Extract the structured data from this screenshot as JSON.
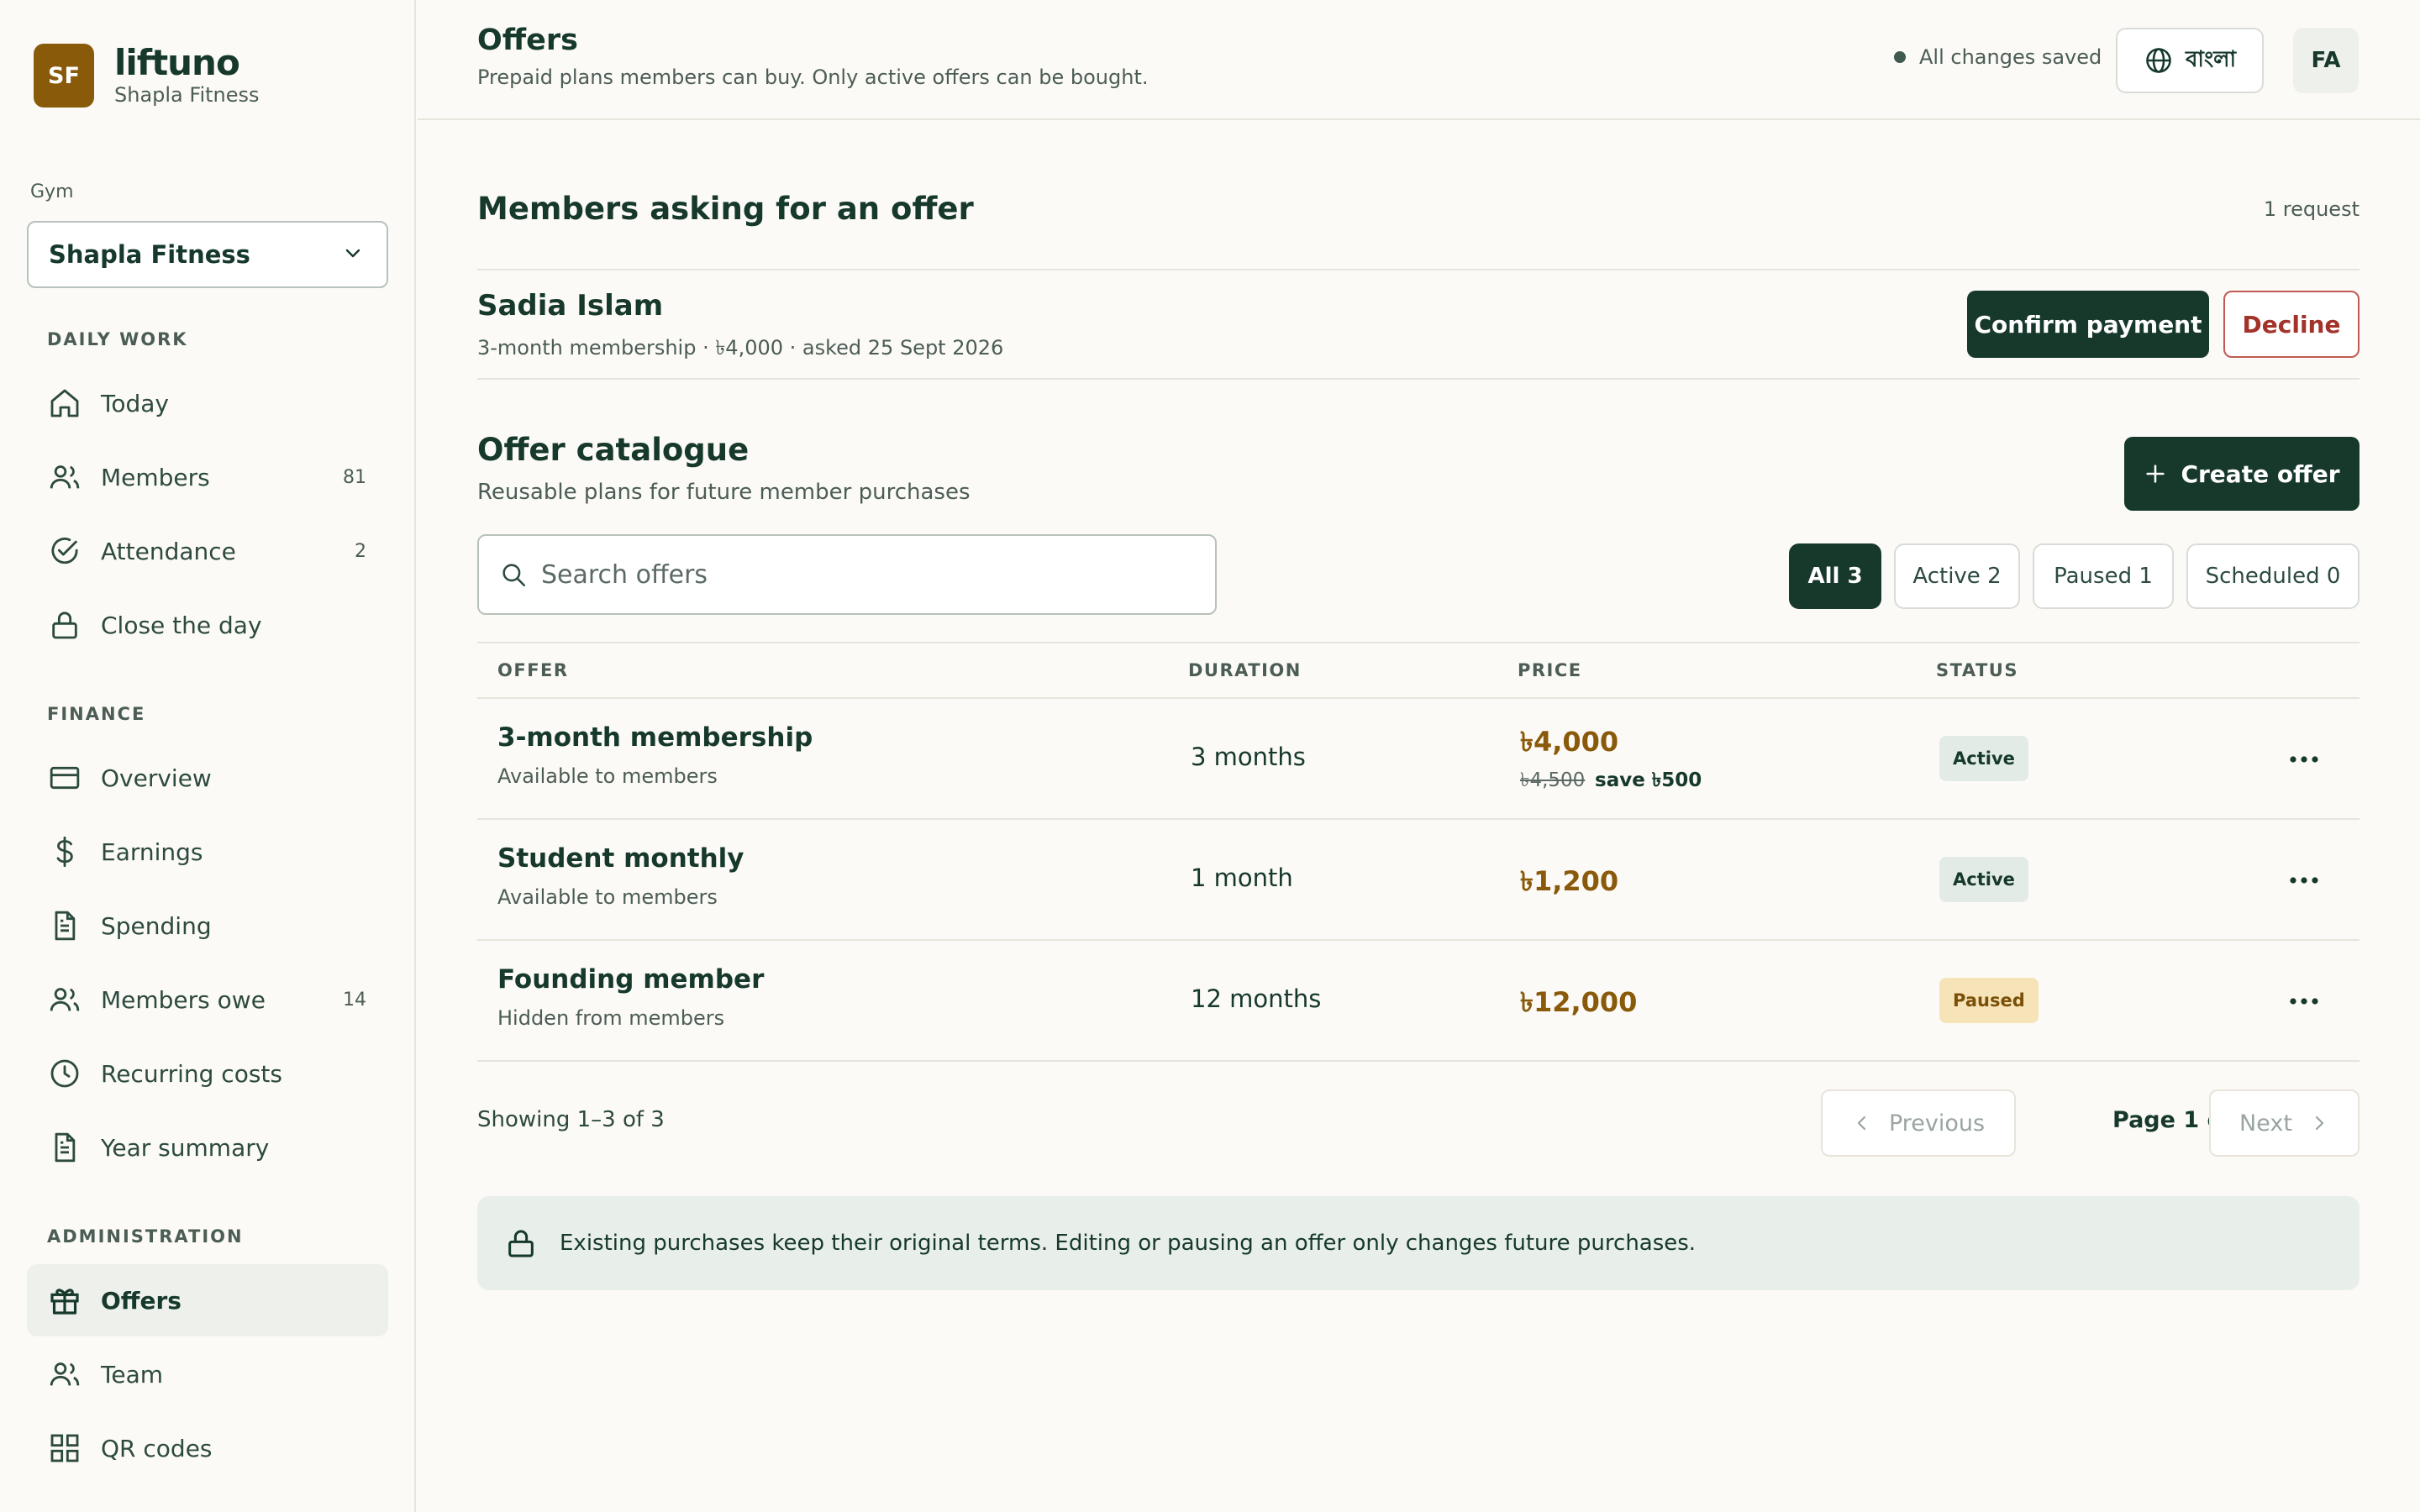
{
  "brand": {
    "initials": "SF",
    "name": "liftuno",
    "sub": "Shapla Fitness"
  },
  "gym": {
    "label": "Gym",
    "value": "Shapla Fitness"
  },
  "nav": {
    "daily_work": "DAILY WORK",
    "today": "Today",
    "members": "Members",
    "members_count": "81",
    "attendance": "Attendance",
    "attendance_count": "2",
    "close_day": "Close the day",
    "finance": "FINANCE",
    "overview": "Overview",
    "earnings": "Earnings",
    "spending": "Spending",
    "members_owe": "Members owe",
    "members_owe_count": "14",
    "recurring": "Recurring costs",
    "year_summary": "Year summary",
    "administration": "ADMINISTRATION",
    "offers": "Offers",
    "team": "Team",
    "qr_codes": "QR codes"
  },
  "header": {
    "title": "Offers",
    "subtitle": "Prepaid plans members can buy. Only active offers can be bought.",
    "saved": "All changes saved",
    "language": "বাংলা",
    "avatar": "FA"
  },
  "requests": {
    "title": "Members asking for an offer",
    "count": "1 request",
    "name": "Sadia Islam",
    "meta": "3-month membership · ৳4,000 · asked 25 Sept 2026",
    "confirm": "Confirm payment",
    "decline": "Decline"
  },
  "catalogue": {
    "title": "Offer catalogue",
    "subtitle": "Reusable plans for future member purchases",
    "create": "Create offer",
    "search_placeholder": "Search offers",
    "filters": {
      "all": "All 3",
      "active": "Active 2",
      "paused": "Paused 1",
      "scheduled": "Scheduled 0"
    },
    "columns": {
      "offer": "OFFER",
      "duration": "DURATION",
      "price": "PRICE",
      "status": "STATUS"
    },
    "rows": [
      {
        "name": "3-month membership",
        "visibility": "Available to members",
        "duration": "3 months",
        "price": "৳4,000",
        "old_price": "৳4,500",
        "save": "save ৳500",
        "status": "Active"
      },
      {
        "name": "Student monthly",
        "visibility": "Available to members",
        "duration": "1 month",
        "price": "৳1,200",
        "status": "Active"
      },
      {
        "name": "Founding member",
        "visibility": "Hidden from members",
        "duration": "12 months",
        "price": "৳12,000",
        "status": "Paused"
      }
    ]
  },
  "pagination": {
    "showing": "Showing 1–3 of 3",
    "previous": "Previous",
    "page": "Page 1 of 1",
    "next": "Next"
  },
  "notice": "Existing purchases keep their original terms. Editing or pausing an offer only changes future purchases."
}
